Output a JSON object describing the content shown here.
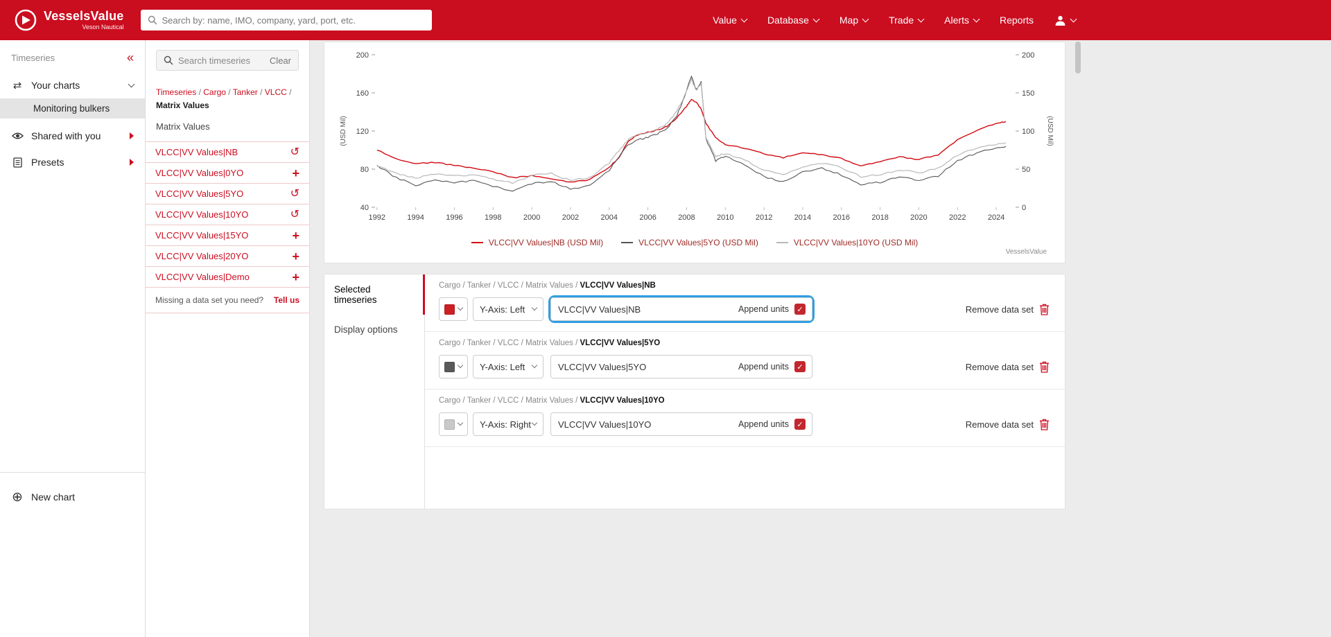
{
  "colors": {
    "accent": "#cb0d20",
    "focus": "#2f9fe3"
  },
  "icons": {
    "collapse": "«",
    "undo": "↺",
    "add": "+",
    "check": "✓",
    "swap": "⇄",
    "new_chart": "⊕"
  },
  "topbar": {
    "brand_name": "VesselsValue",
    "brand_subtitle": "Veson Nautical",
    "search_placeholder": "Search by: name, IMO, company, yard, port, etc.",
    "nav": [
      "Value",
      "Database",
      "Map",
      "Trade",
      "Alerts",
      "Reports"
    ]
  },
  "sidebar": {
    "title": "Timeseries",
    "your_charts": "Your charts",
    "selected_chart": "Monitoring bulkers",
    "shared": "Shared with you",
    "presets": "Presets",
    "new_chart": "New chart"
  },
  "browser": {
    "search_placeholder": "Search timeseries",
    "clear": "Clear",
    "breadcrumb": [
      "Timeseries",
      "Cargo",
      "Tanker",
      "VLCC"
    ],
    "breadcrumb_current": "Matrix Values",
    "folder": "Matrix Values",
    "items": [
      {
        "label": "VLCC|VV Values|NB",
        "action": "undo"
      },
      {
        "label": "VLCC|VV Values|0YO",
        "action": "add"
      },
      {
        "label": "VLCC|VV Values|5YO",
        "action": "undo"
      },
      {
        "label": "VLCC|VV Values|10YO",
        "action": "undo"
      },
      {
        "label": "VLCC|VV Values|15YO",
        "action": "add"
      },
      {
        "label": "VLCC|VV Values|20YO",
        "action": "add"
      },
      {
        "label": "VLCC|VV Values|Demo",
        "action": "add"
      }
    ],
    "missing_text": "Missing a data set you need?",
    "missing_link": "Tell us"
  },
  "chart_data": {
    "type": "line",
    "xlim": [
      1991.9,
      2025.0
    ],
    "x_ticks": [
      1992,
      1994,
      1996,
      1998,
      2000,
      2002,
      2004,
      2006,
      2008,
      2010,
      2012,
      2014,
      2016,
      2018,
      2020,
      2022,
      2024
    ],
    "left_axis": {
      "label": "(USD Mil)",
      "range": [
        40,
        200
      ],
      "ticks": [
        40,
        80,
        120,
        160,
        200
      ]
    },
    "right_axis": {
      "label": "(USD Mil)",
      "range": [
        0,
        200
      ],
      "ticks": [
        0,
        50,
        100,
        150,
        200
      ]
    },
    "x": [
      1992,
      1993,
      1994,
      1995,
      1996,
      1997,
      1998,
      1999,
      2000,
      2001,
      2002,
      2003,
      2004,
      2004.5,
      2005,
      2005.5,
      2006,
      2006.5,
      2007,
      2007.5,
      2008,
      2008.25,
      2008.5,
      2008.75,
      2009,
      2009.5,
      2010,
      2011,
      2012,
      2013,
      2014,
      2015,
      2016,
      2017,
      2018,
      2019,
      2020,
      2021,
      2022,
      2023,
      2024,
      2024.5
    ],
    "series": [
      {
        "name": "VLCC|VV Values|NB",
        "legend_label": "VLCC|VV Values|NB (USD Mil)",
        "axis": "left",
        "color": "#d10a11",
        "values": [
          100,
          91,
          86,
          87,
          84,
          81,
          77,
          71,
          73,
          70,
          66,
          69,
          82,
          92,
          110,
          116,
          119,
          121,
          125,
          134,
          146,
          153,
          150,
          143,
          128,
          113,
          106,
          102,
          96,
          92,
          97,
          95,
          91,
          83,
          88,
          93,
          90,
          95,
          111,
          121,
          128,
          130
        ]
      },
      {
        "name": "VLCC|VV Values|5YO",
        "legend_label": "VLCC|VV Values|5YO (USD Mil)",
        "axis": "left",
        "color": "#555555",
        "values": [
          84,
          71,
          63,
          69,
          66,
          68,
          62,
          57,
          65,
          67,
          59,
          63,
          79,
          93,
          106,
          111,
          113,
          117,
          123,
          136,
          162,
          178,
          163,
          172,
          112,
          89,
          93,
          85,
          72,
          67,
          77,
          81,
          74,
          64,
          66,
          72,
          68,
          73,
          89,
          97,
          102,
          104
        ]
      },
      {
        "name": "VLCC|VV Values|10YO",
        "legend_label": "VLCC|VV Values|10YO (USD Mil)",
        "axis": "right",
        "color": "#b8b8b8",
        "values": [
          54,
          45,
          38,
          44,
          41,
          43,
          37,
          32,
          42,
          44,
          35,
          39,
          58,
          74,
          90,
          95,
          98,
          103,
          110,
          126,
          152,
          168,
          153,
          162,
          92,
          66,
          71,
          62,
          48,
          43,
          53,
          58,
          52,
          40,
          43,
          49,
          45,
          51,
          68,
          78,
          83,
          85
        ]
      }
    ]
  },
  "watermark": "VesselsValue",
  "panel": {
    "tabs": [
      "Selected timeseries",
      "Display options"
    ],
    "append_label": "Append units",
    "remove_label": "Remove data set",
    "rows": [
      {
        "breadcrumb": "Cargo / Tanker / VLCC / Matrix Values / ",
        "name": "VLCC|VV Values|NB",
        "swatch": "#cb1f24",
        "axis_label": "Y-Axis: Left",
        "input_value": "VLCC|VV Values|NB",
        "checked": true
      },
      {
        "breadcrumb": "Cargo / Tanker / VLCC / Matrix Values / ",
        "name": "VLCC|VV Values|5YO",
        "swatch": "#595959",
        "axis_label": "Y-Axis: Left",
        "input_value": "VLCC|VV Values|5YO",
        "checked": true
      },
      {
        "breadcrumb": "Cargo / Tanker / VLCC / Matrix Values / ",
        "name": "VLCC|VV Values|10YO",
        "swatch": "#c9c9c9",
        "axis_label": "Y-Axis: Right",
        "input_value": "VLCC|VV Values|10YO",
        "checked": true
      }
    ]
  }
}
